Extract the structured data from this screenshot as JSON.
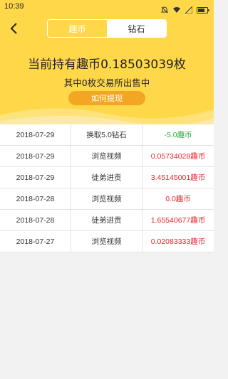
{
  "status_bar": {
    "time": "10:39"
  },
  "colors": {
    "brand_yellow": "#ffd84a",
    "button_orange": "#f3a623",
    "negative_green": "#2ea83a",
    "positive_red": "#e8262b"
  },
  "header": {
    "tabs": [
      {
        "label": "趣币",
        "active": true
      },
      {
        "label": "钻石",
        "active": false
      }
    ],
    "balance_text": "当前持有趣币0.18503039枚",
    "selling_text": "其中0枚交易所出售中",
    "withdraw_label": "如何提现"
  },
  "records": [
    {
      "date": "2018-07-29",
      "type": "换取5.0钻石",
      "amount": "-5.0趣币",
      "sign": "neg"
    },
    {
      "date": "2018-07-29",
      "type": "浏览视频",
      "amount": "0.05734028趣币",
      "sign": "pos"
    },
    {
      "date": "2018-07-29",
      "type": "徒弟进贡",
      "amount": "3.45145001趣币",
      "sign": "pos"
    },
    {
      "date": "2018-07-28",
      "type": "浏览视频",
      "amount": "0.0趣币",
      "sign": "pos"
    },
    {
      "date": "2018-07-28",
      "type": "徒弟进贡",
      "amount": "1.65540677趣币",
      "sign": "pos"
    },
    {
      "date": "2018-07-27",
      "type": "浏览视频",
      "amount": "0.02083333趣币",
      "sign": "pos"
    }
  ]
}
